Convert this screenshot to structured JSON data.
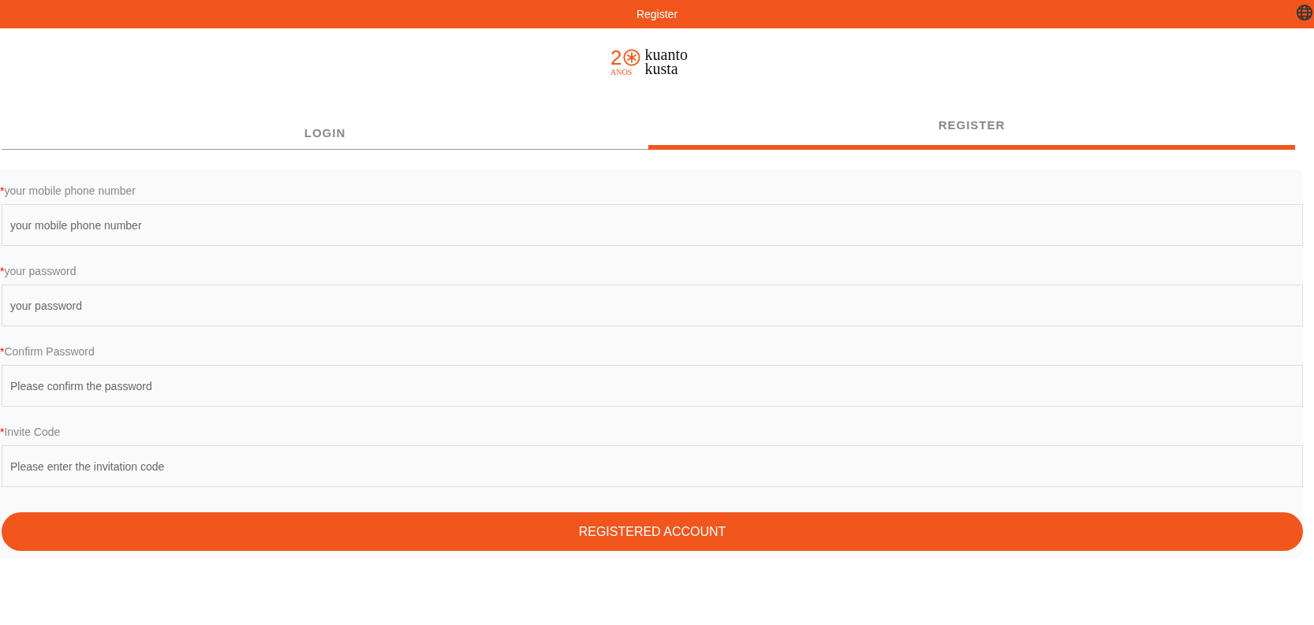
{
  "header": {
    "title": "Register"
  },
  "logo": {
    "number": "2",
    "caption": "ANOS",
    "line_1": "kuanto",
    "line_2": "kusta"
  },
  "tabs": [
    {
      "label": "LOGIN",
      "selected": false
    },
    {
      "label": "REGISTER",
      "selected": true
    }
  ],
  "fields": [
    {
      "mark": "*",
      "label": "your mobile phone number",
      "placeholder": "your mobile phone number"
    },
    {
      "mark": "*",
      "label": "your password",
      "placeholder": "your password"
    },
    {
      "mark": "*",
      "label": "Confirm Password",
      "placeholder": "Please confirm the password"
    },
    {
      "mark": "*",
      "label": "Invite Code",
      "placeholder": "Please enter the invitation code"
    }
  ],
  "submit": {
    "label": "REGISTERED ACCOUNT"
  }
}
